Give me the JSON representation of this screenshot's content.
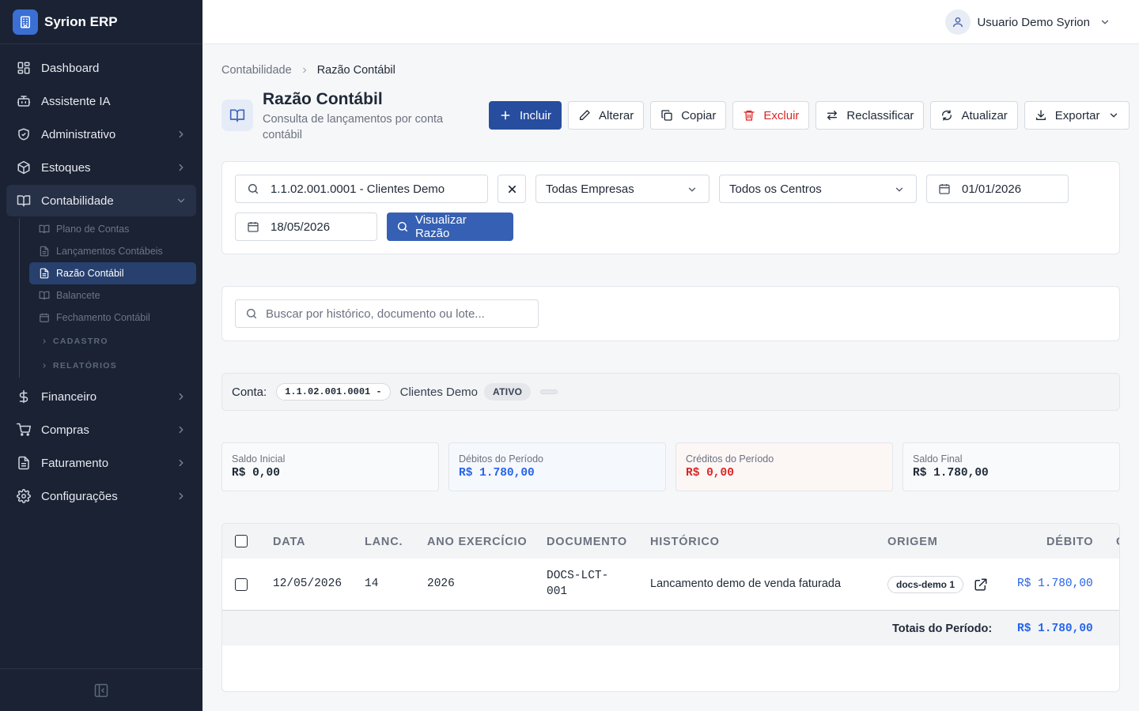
{
  "app": {
    "name": "Syrion ERP"
  },
  "sidebar": {
    "items": [
      {
        "label": "Dashboard",
        "icon": "dashboard-icon"
      },
      {
        "label": "Assistente IA",
        "icon": "bot-icon"
      },
      {
        "label": "Administrativo",
        "icon": "shield-icon"
      },
      {
        "label": "Estoques",
        "icon": "box-icon"
      },
      {
        "label": "Contabilidade",
        "icon": "book-icon"
      },
      {
        "label": "Financeiro",
        "icon": "dollar-icon"
      },
      {
        "label": "Compras",
        "icon": "cart-icon"
      },
      {
        "label": "Faturamento",
        "icon": "file-icon"
      },
      {
        "label": "Configurações",
        "icon": "gear-icon"
      }
    ],
    "sub_items": [
      {
        "label": "Plano de Contas"
      },
      {
        "label": "Lançamentos Contábeis"
      },
      {
        "label": "Razão Contábil"
      },
      {
        "label": "Balancete"
      },
      {
        "label": "Fechamento Contábil"
      }
    ],
    "sub_groups": [
      {
        "label": "CADASTRO"
      },
      {
        "label": "RELATÓRIOS"
      }
    ]
  },
  "header": {
    "user_name": "Usuario Demo Syrion"
  },
  "breadcrumb": {
    "parent": "Contabilidade",
    "current": "Razão Contábil"
  },
  "page": {
    "title": "Razão Contábil",
    "subtitle": "Consulta de lançamentos por conta contábil"
  },
  "toolbar": {
    "incluir": "Incluir",
    "alterar": "Alterar",
    "copiar": "Copiar",
    "excluir": "Excluir",
    "reclassificar": "Reclassificar",
    "atualizar": "Atualizar",
    "exportar": "Exportar"
  },
  "filters": {
    "account": "1.1.02.001.0001 - Clientes Demo",
    "company": "Todas Empresas",
    "cost_center": "Todos os Centros",
    "date_from": "01/01/2026",
    "date_to": "18/05/2026",
    "view_button": "Visualizar Razão"
  },
  "search": {
    "placeholder": "Buscar por histórico, documento ou lote..."
  },
  "account_info": {
    "label": "Conta:",
    "code": "1.1.02.001.0001 -",
    "name": "Clientes Demo",
    "status": "ATIVO"
  },
  "summary": {
    "saldo_inicial": {
      "label": "Saldo Inicial",
      "value": "R$ 0,00"
    },
    "debitos": {
      "label": "Débitos do Período",
      "value": "R$ 1.780,00"
    },
    "creditos": {
      "label": "Créditos do Período",
      "value": "R$ 0,00"
    },
    "saldo_final": {
      "label": "Saldo Final",
      "value": "R$ 1.780,00"
    }
  },
  "table": {
    "columns": [
      "DATA",
      "LANC.",
      "ANO EXERCÍCIO",
      "DOCUMENTO",
      "HISTÓRICO",
      "ORIGEM",
      "DÉBITO",
      "C"
    ],
    "rows": [
      {
        "data": "12/05/2026",
        "lanc": "14",
        "ano": "2026",
        "documento_l1": "DOCS-LCT-",
        "documento_l2": "001",
        "historico": "Lancamento demo de venda faturada",
        "origem": "docs-demo 1",
        "debito": "R$ 1.780,00"
      }
    ],
    "totals_label": "Totais do Período:",
    "totals_debito": "R$ 1.780,00"
  },
  "colors": {
    "sidebar_bg": "#1a2233",
    "primary": "#274d9e",
    "debit_blue": "#2563eb",
    "credit_red": "#dc2626"
  }
}
